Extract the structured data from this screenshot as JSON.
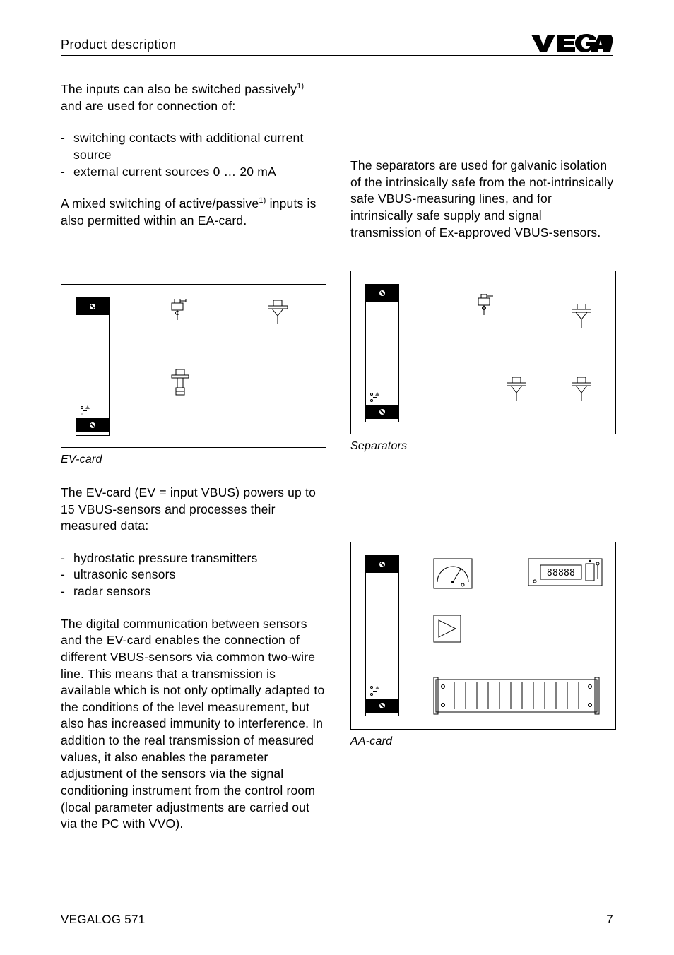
{
  "header": {
    "section": "Product description"
  },
  "left": {
    "p1a": "The inputs can also be switched passively",
    "p1_sup": "1)",
    "p1b": " and are used for connection of:",
    "bullets1": [
      "switching contacts with additional current source",
      "external current sources 0 … 20 mA"
    ],
    "p2a": "A mixed switching of active/passive",
    "p2_sup": "1)",
    "p2b": " inputs is also permitted within an EA-card.",
    "fig1_caption": "EV-card",
    "p3": "The EV-card (EV = input VBUS) powers up to 15 VBUS-sensors and processes their measured data:",
    "bullets2": [
      "hydrostatic pressure transmitters",
      "ultrasonic sensors",
      "radar sensors"
    ],
    "p4": "The digital communication between sensors and the EV-card enables the connection of different VBUS-sensors via common two-wire line. This means that a transmission is available which is not only optimally adapted to the conditions of the level measurement, but also has increased immunity to interference. In addition to the real transmission of measured values, it also enables the parameter adjustment of the sensors via the signal conditioning instrument from the control room (local parameter adjustments are carried out via the PC with VVO)."
  },
  "right": {
    "p1": "The separators are used for galvanic isolation of the intrinsically safe from the not-intrinsically safe VBUS-measuring lines, and for intrinsically safe supply and signal transmission of Ex-approved VBUS-sensors.",
    "fig2_caption": "Separators",
    "fig3_caption": "AA-card",
    "display_digits": "88888"
  },
  "footer": {
    "product": "VEGALOG 571",
    "page": "7"
  }
}
